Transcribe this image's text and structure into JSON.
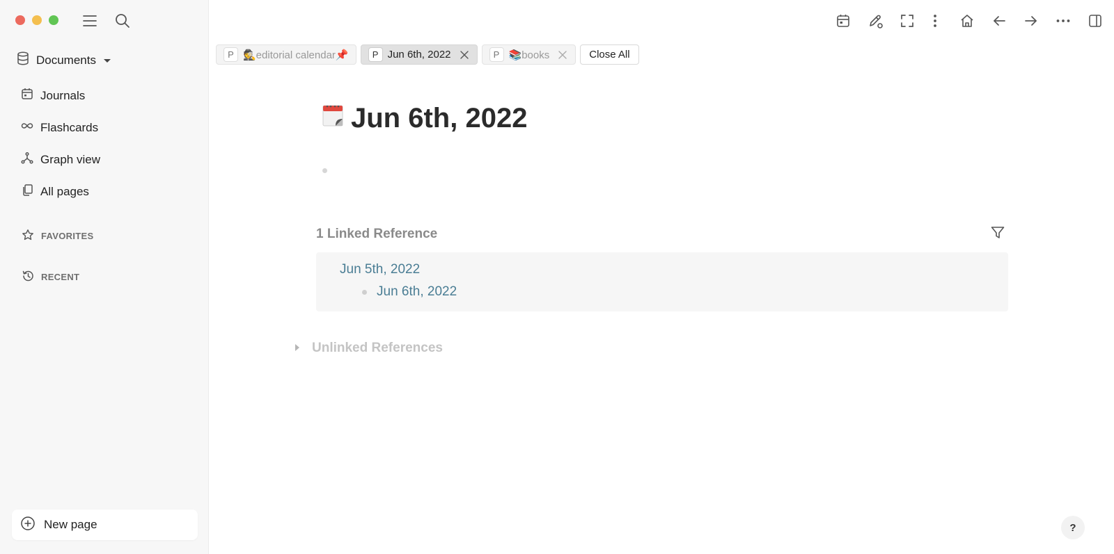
{
  "sidebar": {
    "graph_name": "Documents",
    "nav": [
      {
        "label": "Journals",
        "icon": "calendar-icon"
      },
      {
        "label": "Flashcards",
        "icon": "infinity-icon"
      },
      {
        "label": "Graph view",
        "icon": "graph-icon"
      },
      {
        "label": "All pages",
        "icon": "pages-icon"
      }
    ],
    "favorites_label": "FAVORITES",
    "recent_label": "RECENT",
    "new_page_label": "New page"
  },
  "tabs": [
    {
      "badge": "P",
      "label": "🕵editorial calendar📌",
      "active": false,
      "closable": false
    },
    {
      "badge": "P",
      "label": "Jun 6th, 2022",
      "active": true,
      "closable": true
    },
    {
      "badge": "P",
      "label": "📚books",
      "active": false,
      "closable": true
    }
  ],
  "close_all_label": "Close All",
  "page": {
    "title": "Jun 6th, 2022",
    "title_icon": "calendar-emoji",
    "linked_heading": "1 Linked Reference",
    "references": [
      {
        "page": "Jun 5th, 2022",
        "block": "Jun 6th, 2022"
      }
    ],
    "unlinked_heading": "Unlinked References"
  },
  "help_label": "?",
  "colors": {
    "sidebar_bg": "#f7f7f7",
    "link": "#4a7d94",
    "ref_bg": "#f6f6f6"
  }
}
